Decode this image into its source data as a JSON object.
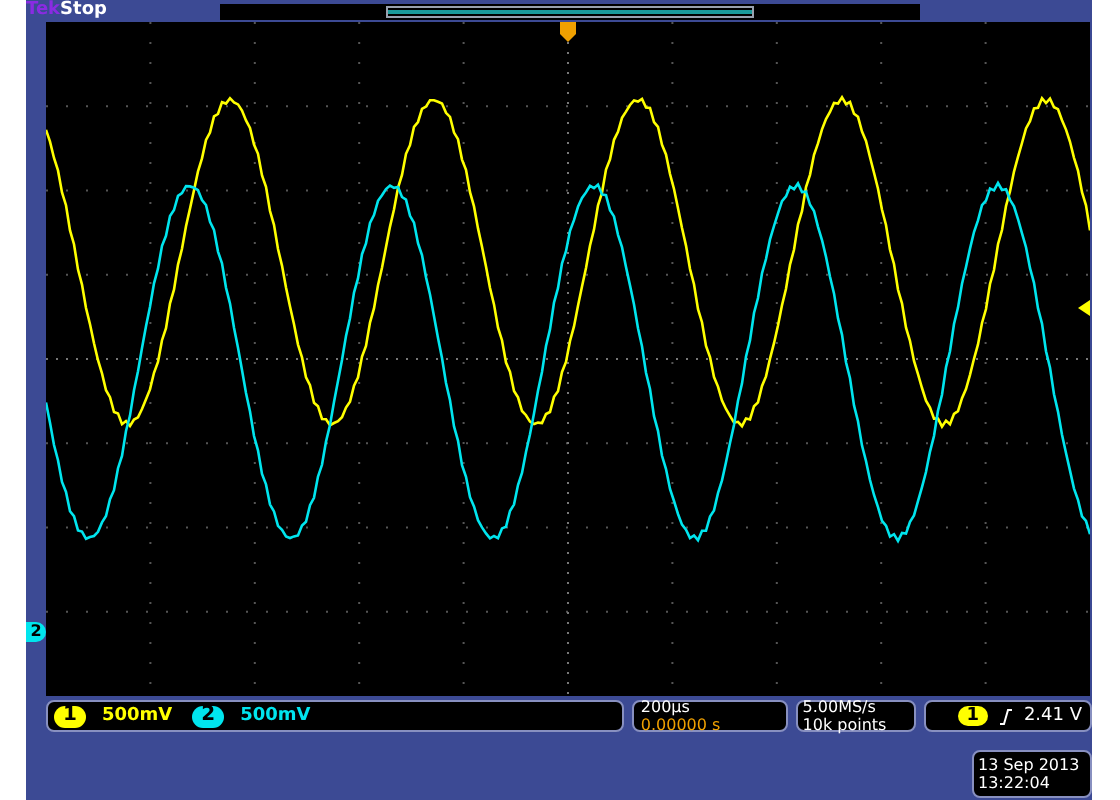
{
  "header": {
    "brand": "Tek",
    "status": "Stop"
  },
  "channels": [
    {
      "number": "1",
      "scale": "500mV",
      "color": "#ffff00"
    },
    {
      "number": "2",
      "scale": "500mV",
      "color": "#00e5ee"
    }
  ],
  "ground_marker": {
    "label": "2"
  },
  "timebase": {
    "scale": "200µs",
    "delay": "0.00000 s"
  },
  "acquisition": {
    "rate": "5.00MS/s",
    "record": "10k points"
  },
  "trigger": {
    "source": "1",
    "level": "2.41 V"
  },
  "datetime": {
    "date": "13 Sep 2013",
    "time": "13:22:04"
  }
}
